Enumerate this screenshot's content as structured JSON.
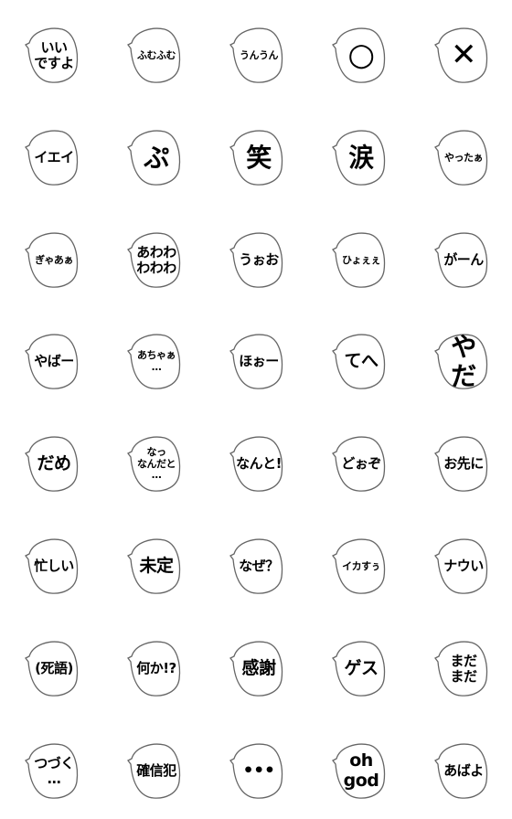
{
  "stickers": [
    {
      "text": "いい\nですよ"
    },
    {
      "text": "ふむふむ"
    },
    {
      "text": "うんうん"
    },
    {
      "text": "○"
    },
    {
      "text": "✕"
    },
    {
      "text": "イエイ"
    },
    {
      "text": "ぷ"
    },
    {
      "text": "笑"
    },
    {
      "text": "涙"
    },
    {
      "text": "やったぁ"
    },
    {
      "text": "ぎゃあぁ"
    },
    {
      "text": "あわわ\nわわわ"
    },
    {
      "text": "うぉお"
    },
    {
      "text": "ひょぇぇ"
    },
    {
      "text": "がーん"
    },
    {
      "text": "やばー"
    },
    {
      "text": "あちゃぁ\n…"
    },
    {
      "text": "ほぉー"
    },
    {
      "text": "てへ"
    },
    {
      "text": "やだ"
    },
    {
      "text": "だめ"
    },
    {
      "text": "なっ\nなんだと\n…"
    },
    {
      "text": "なんと!"
    },
    {
      "text": "どぉぞ"
    },
    {
      "text": "お先に"
    },
    {
      "text": "忙しい"
    },
    {
      "text": "未定"
    },
    {
      "text": "なぜ？"
    },
    {
      "text": "イカすぅ"
    },
    {
      "text": "ナウい"
    },
    {
      "text": "(死語)"
    },
    {
      "text": "何か!?"
    },
    {
      "text": "感謝"
    },
    {
      "text": "ゲス"
    },
    {
      "text": "まだ\nまだ"
    },
    {
      "text": "つづく\n…"
    },
    {
      "text": "確信犯"
    },
    {
      "text": "•••"
    },
    {
      "text": "oh\ngod"
    },
    {
      "text": "あばよ"
    }
  ],
  "colors": {
    "bubble_stroke": "#666666",
    "bubble_fill": "#ffffff",
    "text": "#000000"
  }
}
